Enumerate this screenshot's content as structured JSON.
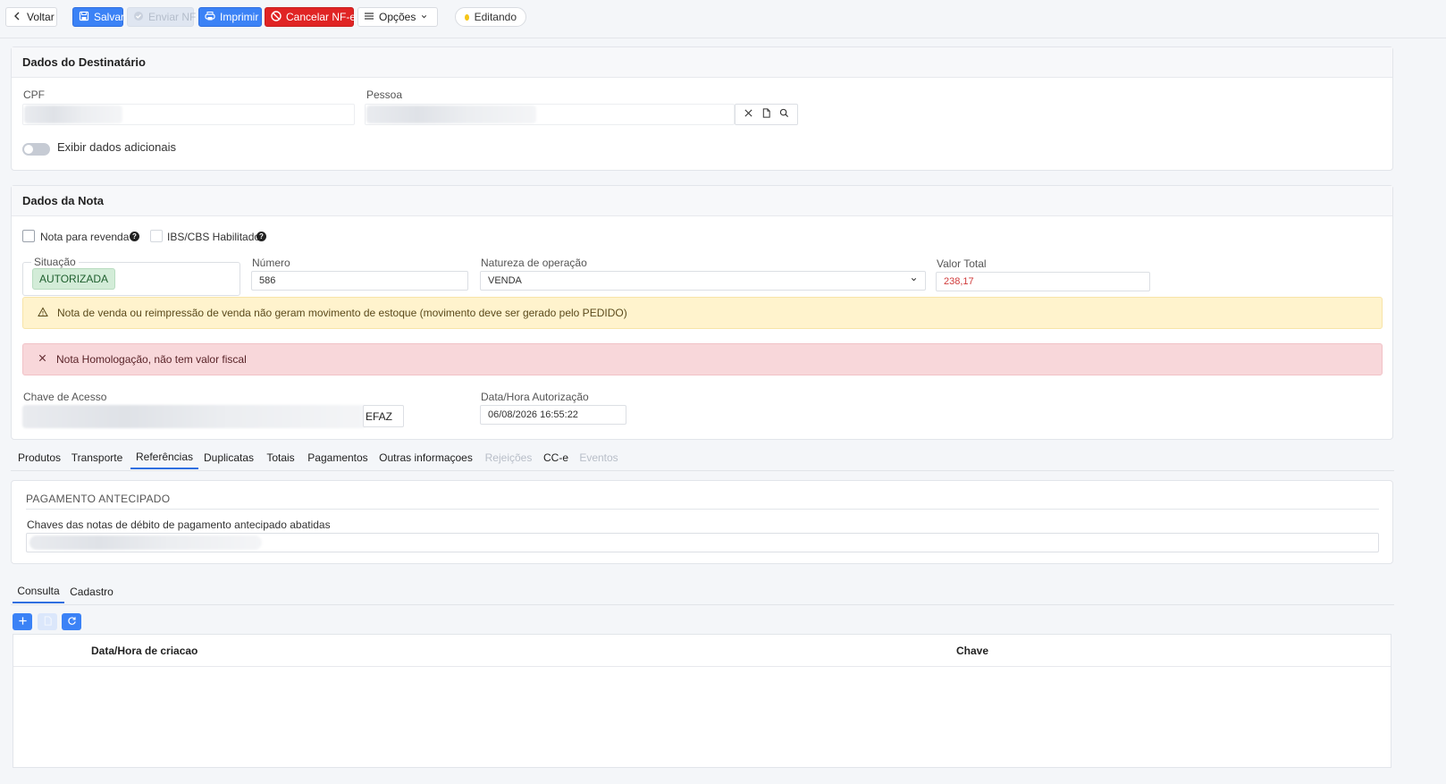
{
  "toolbar": {
    "back_label": "Voltar",
    "save_label": "Salvar",
    "send_label": "Enviar NF",
    "print_label": "Imprimir",
    "cancel_label": "Cancelar NF-e",
    "options_label": "Opções",
    "status_label": "Editando"
  },
  "destinatario": {
    "title": "Dados do Destinatário",
    "cpf_label": "CPF",
    "pessoa_label": "Pessoa",
    "toggle_label": "Exibir dados adicionais"
  },
  "nota": {
    "title": "Dados da Nota",
    "revenda_label": "Nota para revenda",
    "ibs_label": "IBS/CBS Habilitado",
    "situacao_label": "Situação",
    "situacao_value": "AUTORIZADA",
    "numero_label": "Número",
    "numero_value": "586",
    "natureza_label": "Natureza de operação",
    "natureza_value": "VENDA",
    "valor_label": "Valor Total",
    "valor_value": "238,17",
    "warning_text": "Nota de venda ou reimpressão de venda não geram movimento de estoque (movimento deve ser gerado pelo PEDIDO)",
    "error_text": "Nota Homologação, não tem valor fiscal",
    "chave_label": "Chave de Acesso",
    "chave_button": "EFAZ",
    "autorizacao_label": "Data/Hora Autorização",
    "autorizacao_value": "06/08/2026 16:55:22"
  },
  "tabs": [
    "Produtos",
    "Transporte",
    "Referências",
    "Duplicatas",
    "Totais",
    "Pagamentos",
    "Outras informaçoes",
    "Rejeições",
    "CC-e",
    "Eventos"
  ],
  "pagamento": {
    "section_title": "PAGAMENTO ANTECIPADO",
    "chaves_label": "Chaves das notas de débito de pagamento antecipado abatidas"
  },
  "subtabs": [
    "Consulta",
    "Cadastro"
  ],
  "grid": {
    "col_date": "Data/Hora de criacao",
    "col_chave": "Chave"
  },
  "colors": {
    "primary": "#3b82f6",
    "danger": "#e02424",
    "warning_bg": "#fff3cd",
    "error_bg": "#f8d7da",
    "success_bg": "#d3ecd8",
    "status_dot": "#f5c518",
    "value_red": "#d03b3b"
  }
}
